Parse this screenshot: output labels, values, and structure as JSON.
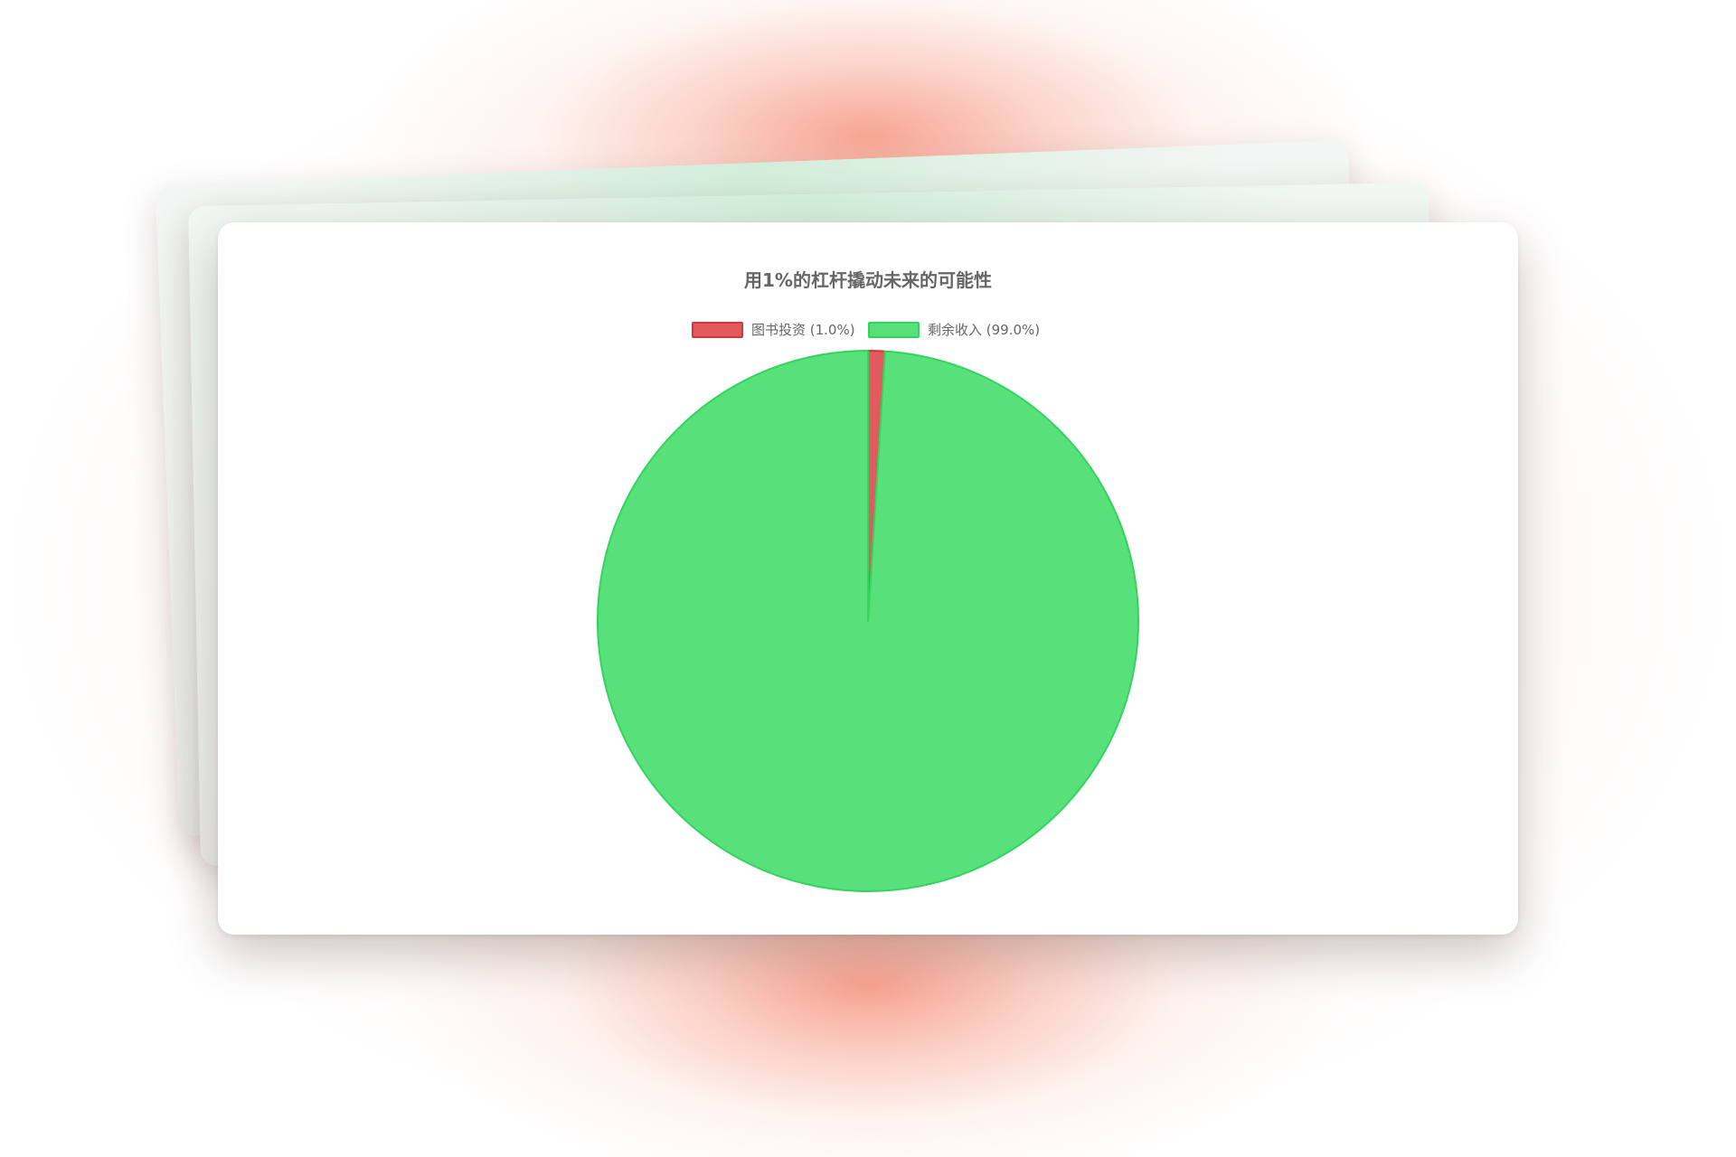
{
  "chart_data": {
    "type": "pie",
    "title": "用1%的杠杆撬动未来的可能性",
    "legend_position": "top",
    "slices": [
      {
        "label": "图书投资",
        "legend_text": "图书投资 (1.0%)",
        "value": 1.0,
        "fill": "#e05a5e",
        "stroke": "#d6353b"
      },
      {
        "label": "剩余收入",
        "legend_text": "剩余收入 (99.0%)",
        "value": 99.0,
        "fill": "#58e07b",
        "stroke": "#33d35e"
      }
    ]
  }
}
